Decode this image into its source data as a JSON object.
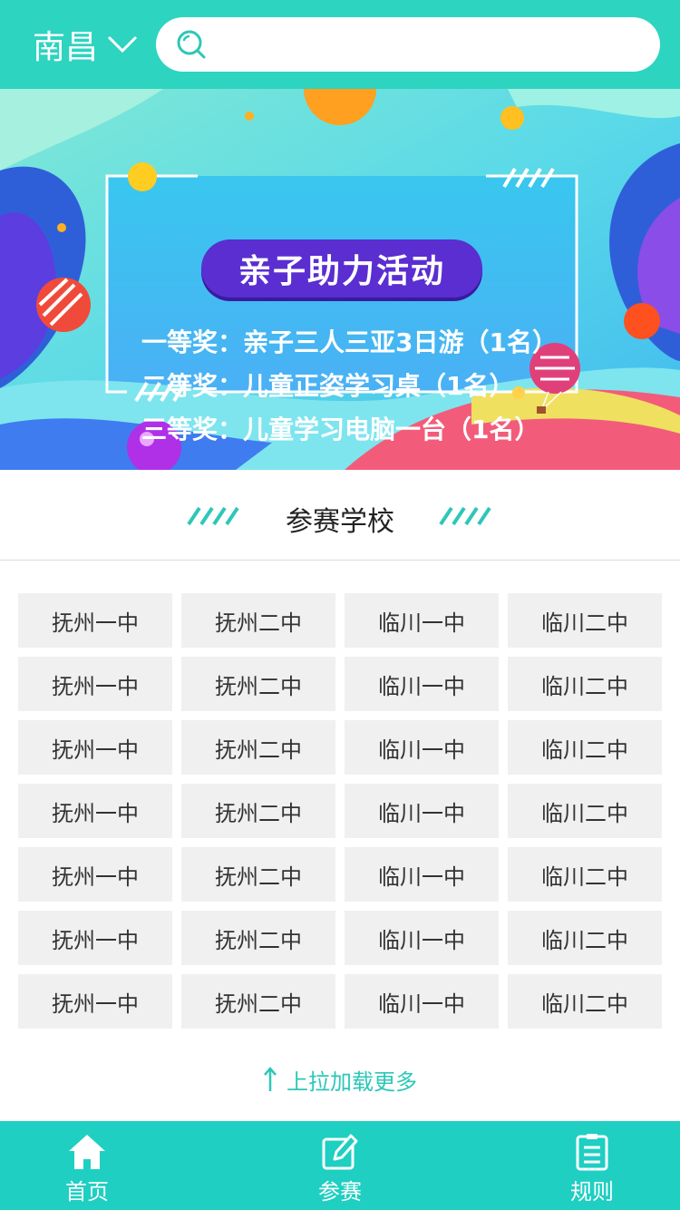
{
  "header": {
    "city": "南昌",
    "search_placeholder": ""
  },
  "banner": {
    "title": "亲子助力活动",
    "prizes": [
      "一等奖：亲子三人三亚3日游（1名）",
      "二等奖：儿童正姿学习桌（1名）",
      "三等奖：儿童学习电脑一台（1名）"
    ]
  },
  "section": {
    "title": "参赛学校"
  },
  "schools": [
    [
      "抚州一中",
      "抚州二中",
      "临川一中",
      "临川二中"
    ],
    [
      "抚州一中",
      "抚州二中",
      "临川一中",
      "临川二中"
    ],
    [
      "抚州一中",
      "抚州二中",
      "临川一中",
      "临川二中"
    ],
    [
      "抚州一中",
      "抚州二中",
      "临川一中",
      "临川二中"
    ],
    [
      "抚州一中",
      "抚州二中",
      "临川一中",
      "临川二中"
    ],
    [
      "抚州一中",
      "抚州二中",
      "临川一中",
      "临川二中"
    ],
    [
      "抚州一中",
      "抚州二中",
      "临川一中",
      "临川二中"
    ]
  ],
  "load_more": "上拉加载更多",
  "tabs": [
    {
      "label": "首页",
      "icon": "home-icon"
    },
    {
      "label": "参赛",
      "icon": "edit-icon"
    },
    {
      "label": "规则",
      "icon": "list-icon"
    }
  ],
  "colors": {
    "accent": "#2dd4c0",
    "tabbar": "#1ecfc2",
    "banner_title_bg": "#5a2ed0",
    "cell_bg": "#f0f0f0"
  }
}
